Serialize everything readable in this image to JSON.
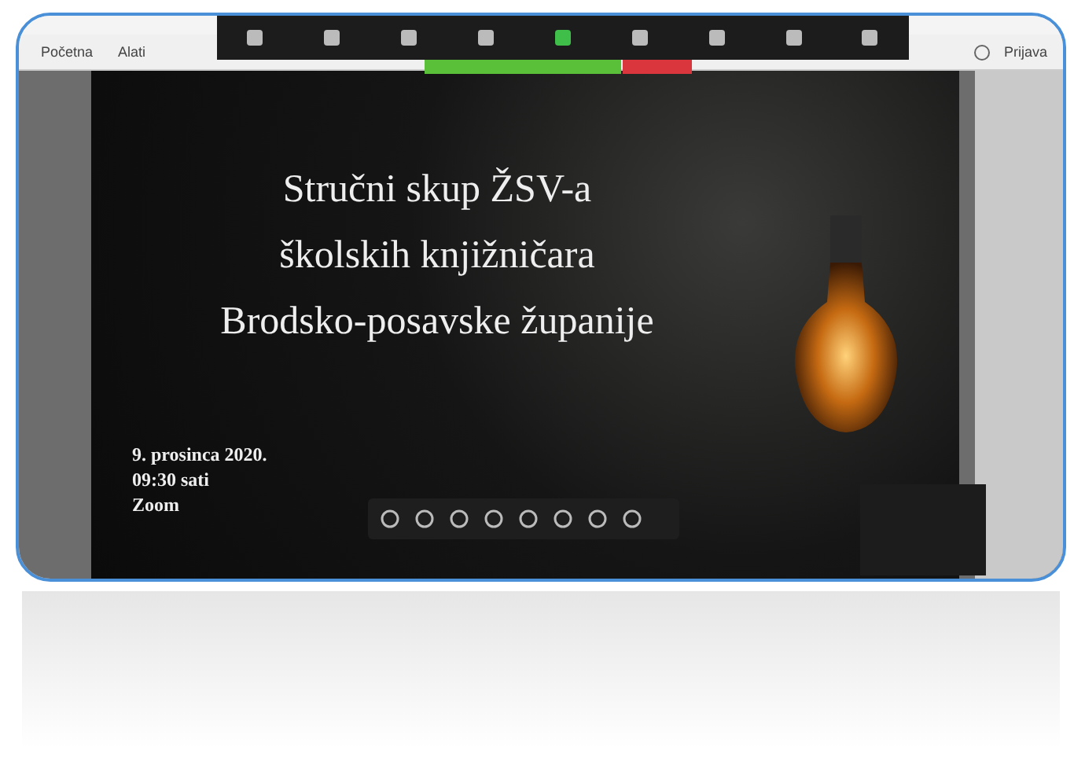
{
  "toolbar": {
    "tabs": [
      {
        "label": "Početna",
        "selected": false
      },
      {
        "label": "Alati",
        "selected": false
      }
    ],
    "sign_in": "Prijava"
  },
  "slide": {
    "title_lines": [
      "Stručni skup ŽSV-a",
      "školskih knjižničara",
      "Brodsko-posavske županije"
    ],
    "details": [
      "9. prosinca 2020.",
      "09:30 sati",
      "Zoom"
    ]
  }
}
